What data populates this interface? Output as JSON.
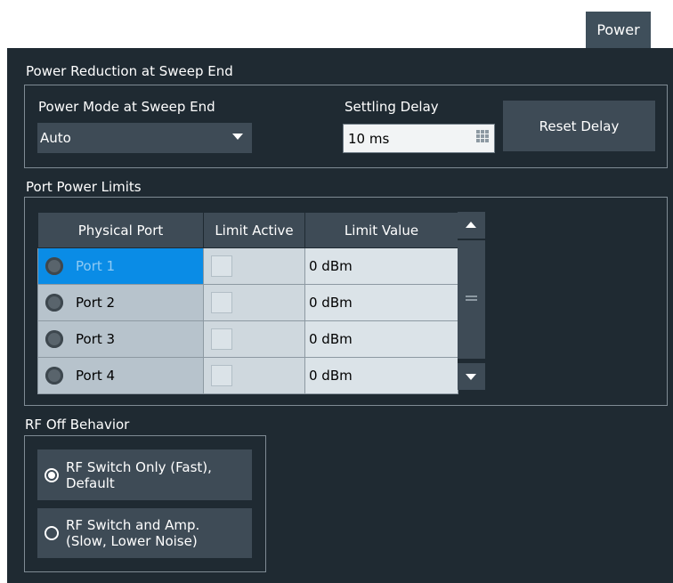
{
  "tab": {
    "label": "Power"
  },
  "power_reduction": {
    "title": "Power Reduction at Sweep End",
    "power_mode": {
      "label": "Power Mode at Sweep End",
      "value": "Auto"
    },
    "settling_delay": {
      "label": "Settling Delay",
      "value": "10 ms"
    },
    "reset_button": "Reset Delay"
  },
  "port_power_limits": {
    "title": "Port Power Limits",
    "columns": [
      "Physical Port",
      "Limit Active",
      "Limit Value"
    ],
    "rows": [
      {
        "port": "Port 1",
        "limit_active": false,
        "limit_value": "0 dBm",
        "selected": true
      },
      {
        "port": "Port 2",
        "limit_active": false,
        "limit_value": "0 dBm",
        "selected": false
      },
      {
        "port": "Port 3",
        "limit_active": false,
        "limit_value": "0 dBm",
        "selected": false
      },
      {
        "port": "Port 4",
        "limit_active": false,
        "limit_value": "0 dBm",
        "selected": false
      }
    ]
  },
  "rf_off": {
    "title": "RF Off Behavior",
    "options": [
      {
        "line1": "RF Switch Only (Fast),",
        "line2": "Default",
        "selected": true
      },
      {
        "line1": "RF Switch and Amp.",
        "line2": "(Slow, Lower Noise)",
        "selected": false
      }
    ]
  },
  "colors": {
    "panel": "#1f2a32",
    "control": "#3e4b56",
    "selected_row": "#0a8ce6",
    "port_cell": "#b7c3cc"
  }
}
